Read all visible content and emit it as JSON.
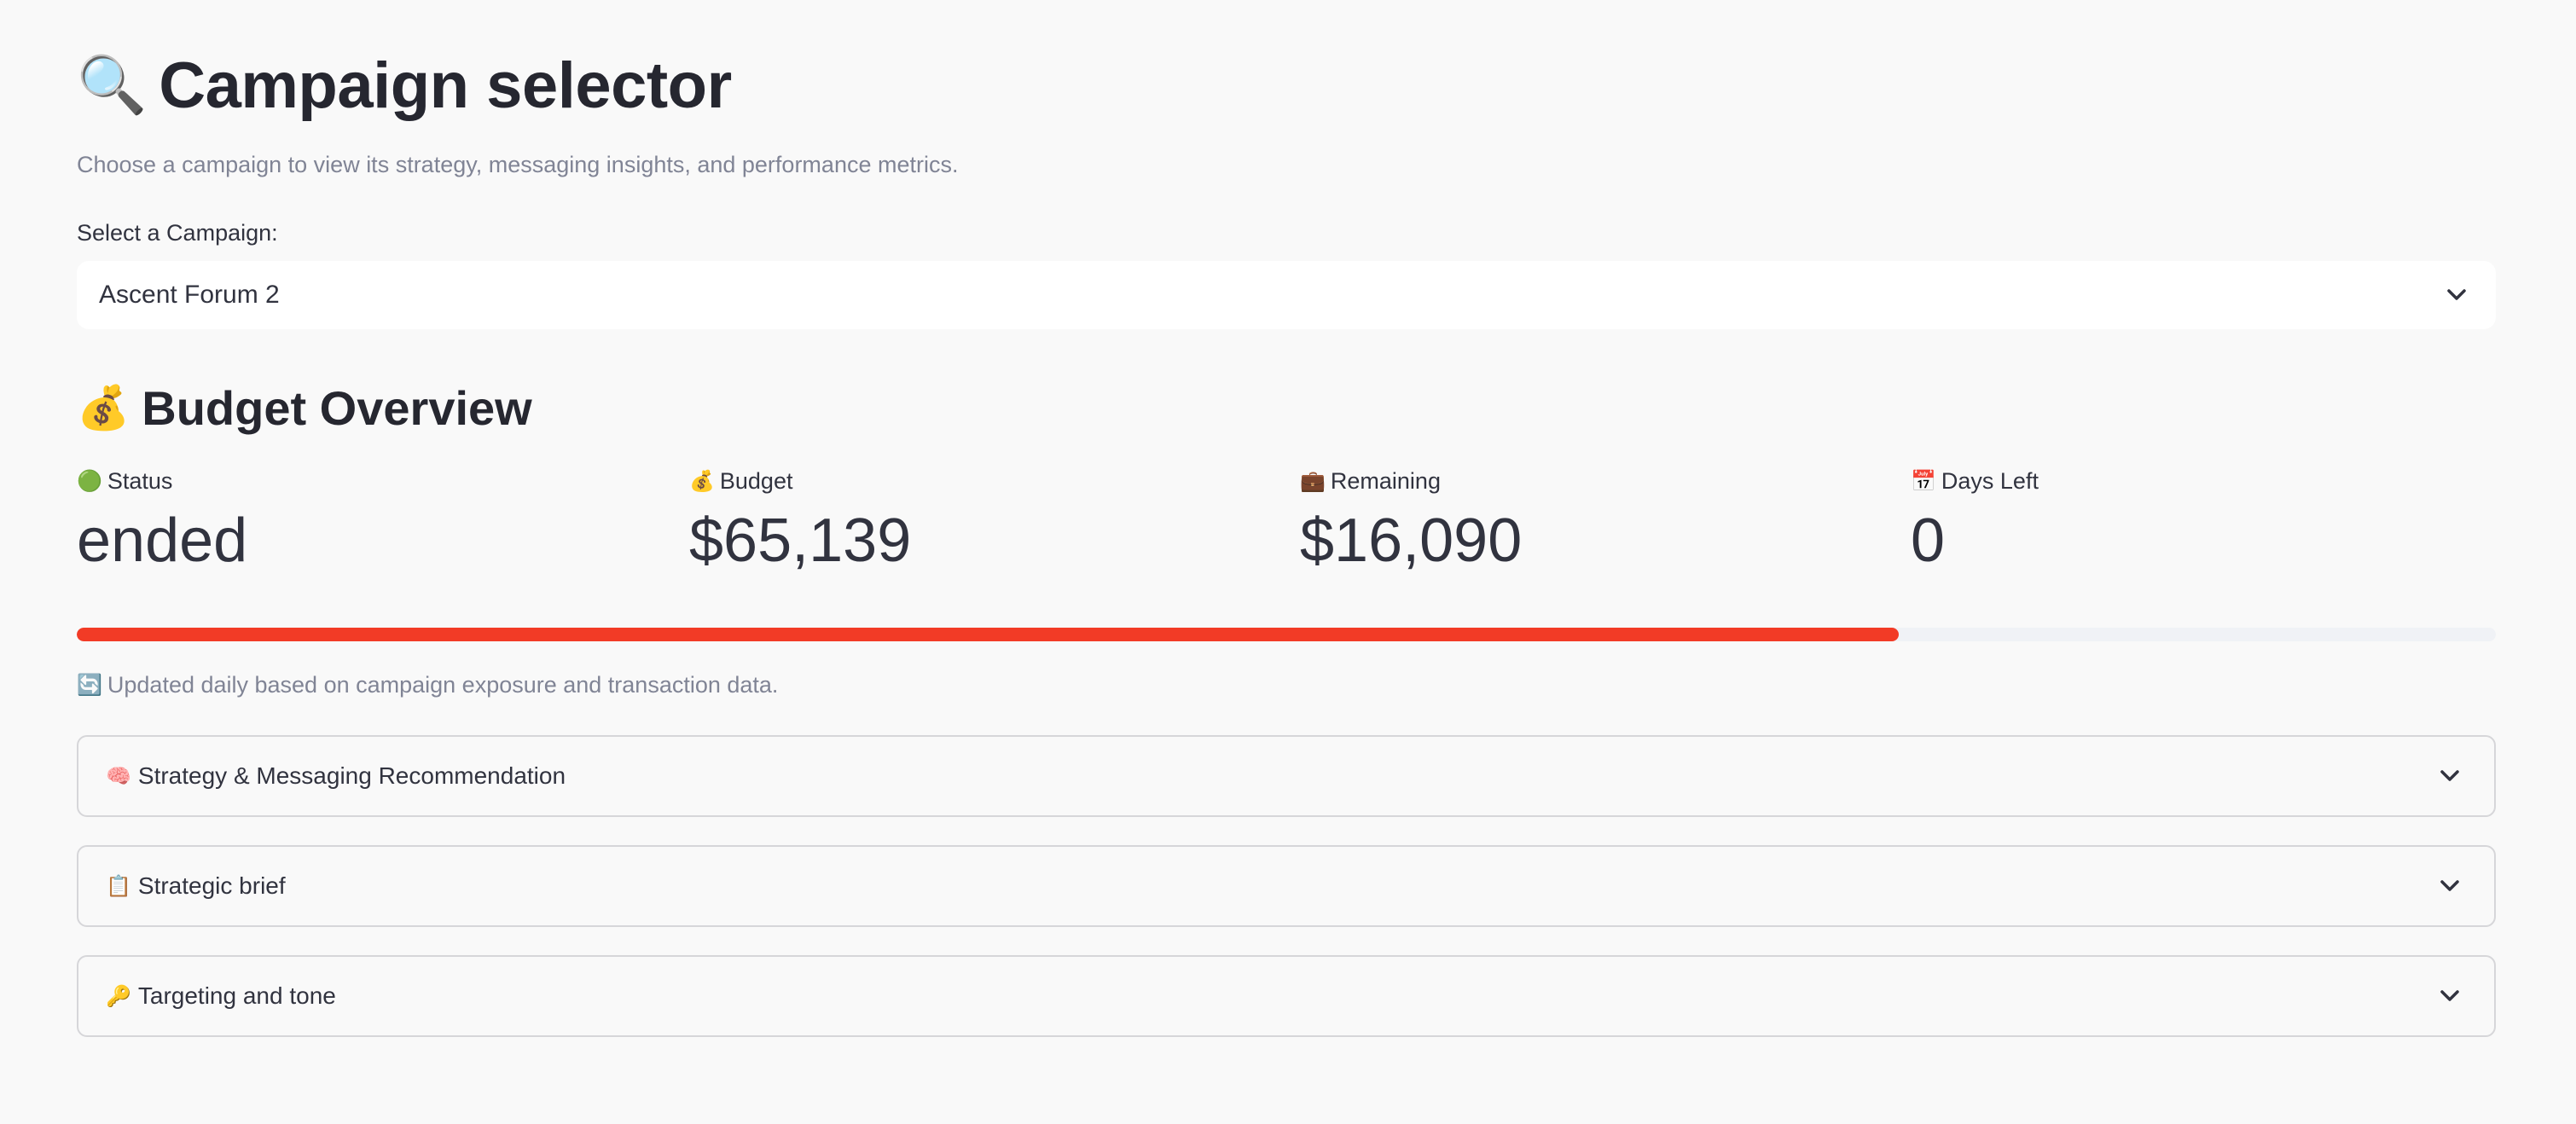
{
  "header": {
    "title_icon": "🔍",
    "title": "Campaign selector",
    "subtitle": "Choose a campaign to view its strategy, messaging insights, and performance metrics."
  },
  "campaign_select": {
    "label": "Select a Campaign:",
    "selected_value": "Ascent Forum 2",
    "icon": "chevron-down-icon"
  },
  "budget_overview": {
    "icon": "💰",
    "title": "Budget Overview",
    "metrics": [
      {
        "icon": "🟢",
        "label": "Status",
        "value": "ended"
      },
      {
        "icon": "💰",
        "label": "Budget",
        "value": "$65,139"
      },
      {
        "icon": "💼",
        "label": "Remaining",
        "value": "$16,090"
      },
      {
        "icon": "📅",
        "label": "Days Left",
        "value": "0"
      }
    ],
    "progress": {
      "fraction": 0.753,
      "color": "#f23b26"
    },
    "caption_icon": "🔄",
    "caption": "Updated daily based on campaign exposure and transaction data."
  },
  "expanders": [
    {
      "icon": "🧠",
      "label": "Strategy & Messaging Recommendation"
    },
    {
      "icon": "📋",
      "label": "Strategic brief"
    },
    {
      "icon": "🔑",
      "label": "Targeting and tone"
    }
  ],
  "colors": {
    "background": "#f9f9f9",
    "accent": "#f23b26",
    "muted_text": "#808495"
  }
}
